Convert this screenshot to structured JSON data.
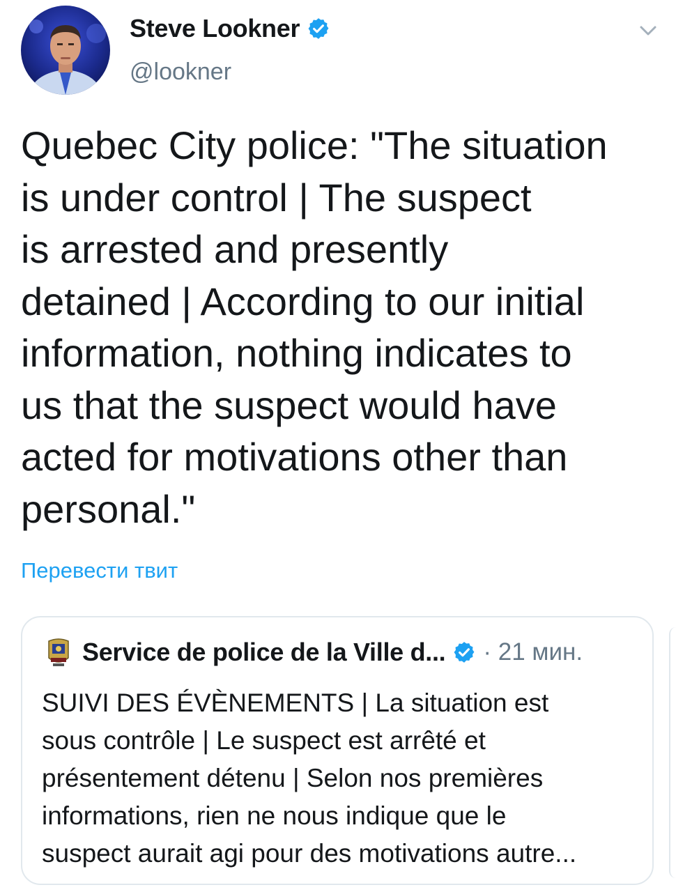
{
  "author": {
    "display_name": "Steve Lookner",
    "handle": "@lookner",
    "verified_icon": "verified-badge-icon",
    "avatar": "profile-photo"
  },
  "menu_icon": "chevron-down-icon",
  "tweet": {
    "lines": [
      "Quebec City police: \"The situation",
      "is under control | The suspect",
      "is arrested and presently",
      "detained | According to our initial",
      "information, nothing indicates to",
      "us that the suspect would have",
      "acted for motivations other than",
      "personal.\""
    ],
    "translate_label": "Перевести твит"
  },
  "quoted": {
    "display_name": "Service de police de la Ville d...",
    "time": "· 21 мин.",
    "verified_icon": "verified-badge-icon",
    "logo_icon": "police-crest-icon",
    "lines": [
      "SUIVI DES ÉVÈNEMENTS | La situation est",
      "sous contrôle | Le suspect est arrêté et",
      "présentement détenu | Selon nos premières",
      "informations, rien ne nous indique que le",
      "suspect aurait agi pour des motivations autre..."
    ]
  },
  "colors": {
    "accent": "#1da1f2",
    "text": "#14171a",
    "secondary": "#657786",
    "border": "#e1e8ed"
  }
}
